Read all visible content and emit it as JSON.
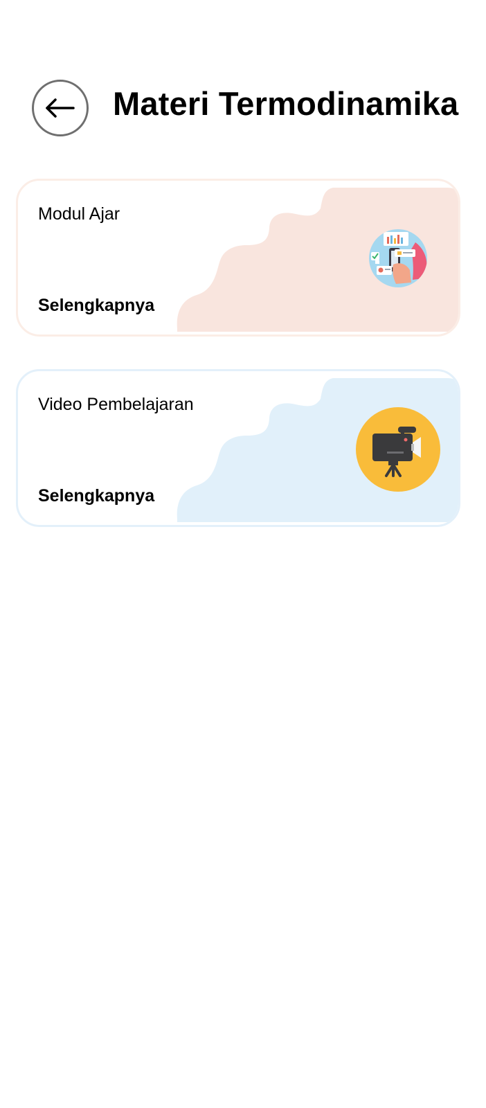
{
  "header": {
    "back_icon": "arrow-left-icon",
    "title": "Materi Termodinamika"
  },
  "cards": [
    {
      "title": "Modul Ajar",
      "action_label": "Selengkapnya",
      "icon": "document-analytics-icon",
      "accent": "#f9e5de"
    },
    {
      "title": "Video Pembelajaran",
      "action_label": "Selengkapnya",
      "icon": "video-camera-icon",
      "accent": "#e1f0fa"
    }
  ],
  "colors": {
    "background": "#ffffff",
    "modul_border": "#fbede6",
    "video_border": "#e3f0fa",
    "video_icon_circle": "#f9bc3a",
    "modul_icon_circle": "#a5d8f0",
    "text": "#000000"
  }
}
